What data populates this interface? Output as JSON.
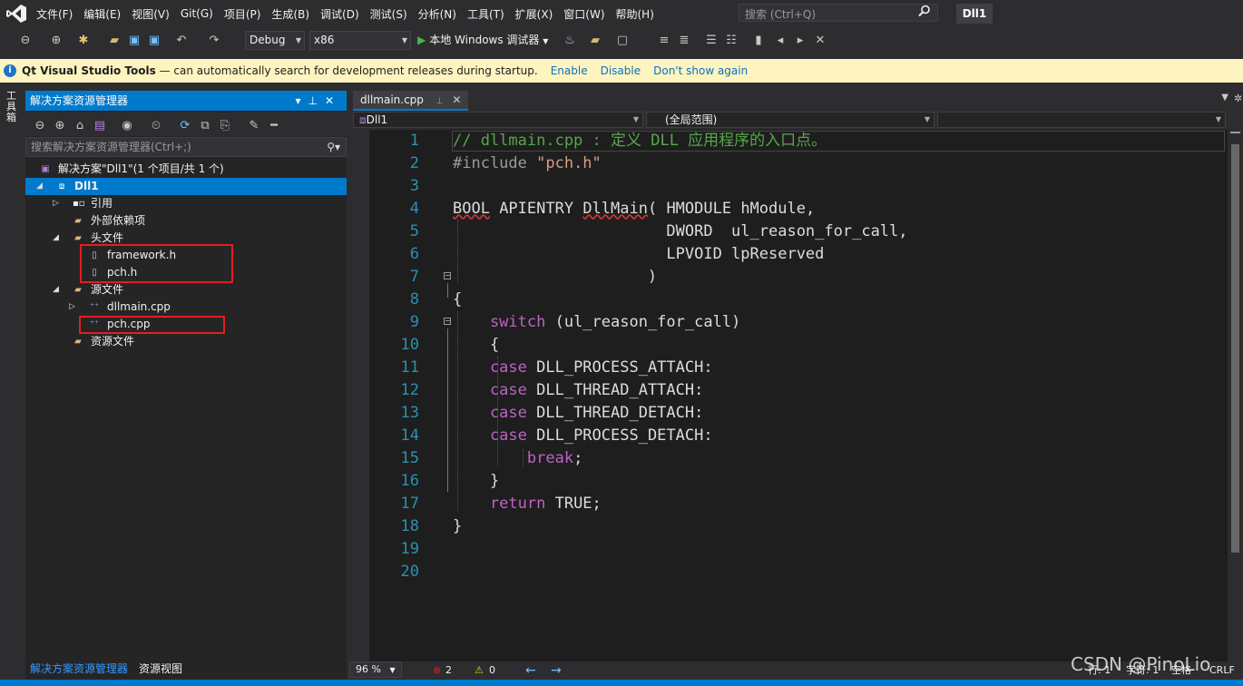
{
  "menubar": {
    "items": [
      "文件(F)",
      "编辑(E)",
      "视图(V)",
      "Git(G)",
      "项目(P)",
      "生成(B)",
      "调试(D)",
      "测试(S)",
      "分析(N)",
      "工具(T)",
      "扩展(X)",
      "窗口(W)",
      "帮助(H)"
    ],
    "search_placeholder": "搜索 (Ctrl+Q)",
    "project_title": "Dll1"
  },
  "toolbar": {
    "config": "Debug",
    "platform": "x86",
    "run_label": "本地 Windows 调试器"
  },
  "infobar": {
    "product": "Qt Visual Studio Tools",
    "message": "—  can automatically search for development releases during startup.",
    "enable": "Enable",
    "disable": "Disable",
    "dont_show": "Don't show again"
  },
  "left_strip": {
    "label": "工具箱"
  },
  "solution_explorer": {
    "title": "解决方案资源管理器",
    "search_placeholder": "搜索解决方案资源管理器(Ctrl+;)",
    "tree": [
      {
        "label": "解决方案\"Dll1\"(1 个项目/共 1 个)"
      },
      {
        "label": "Dll1"
      },
      {
        "label": "引用"
      },
      {
        "label": "外部依赖项"
      },
      {
        "label": "头文件"
      },
      {
        "label": "framework.h"
      },
      {
        "label": "pch.h"
      },
      {
        "label": "源文件"
      },
      {
        "label": "dllmain.cpp"
      },
      {
        "label": "pch.cpp"
      },
      {
        "label": "资源文件"
      }
    ],
    "tabs": [
      "解决方案资源管理器",
      "资源视图"
    ]
  },
  "editor": {
    "tab_label": "dllmain.cpp",
    "nav_project": "Dll1",
    "nav_scope": "(全局范围)",
    "line_numbers": [
      "1",
      "2",
      "3",
      "4",
      "5",
      "6",
      "7",
      "8",
      "9",
      "10",
      "11",
      "12",
      "13",
      "14",
      "15",
      "16",
      "17",
      "18",
      "19",
      "20"
    ],
    "lines": {
      "l1": "// dllmain.cpp : 定义 DLL 应用程序的入口点。",
      "l2a": "#include ",
      "l2b": "\"pch.h\"",
      "l4a": "BOOL",
      "l4b": " APIENTRY ",
      "l4c": "DllMain",
      "l4d": "( HMODULE hModule,",
      "l5": "                       DWORD  ul_reason_for_call,",
      "l6": "                       LPVOID lpReserved",
      "l7": "                     )",
      "l8": "{",
      "l9a": "    switch",
      "l9b": " (ul_reason_for_call)",
      "l10": "    {",
      "l11a": "    case",
      "l11b": " DLL_PROCESS_ATTACH:",
      "l12a": "    case",
      "l12b": " DLL_THREAD_ATTACH:",
      "l13a": "    case",
      "l13b": " DLL_THREAD_DETACH:",
      "l14a": "    case",
      "l14b": " DLL_PROCESS_DETACH:",
      "l15": "        break",
      "l15b": ";",
      "l16": "    }",
      "l17a": "    return",
      "l17b": " TRUE;",
      "l18": "}"
    }
  },
  "status": {
    "zoom": "96 %",
    "errors": "2",
    "warnings": "0",
    "line": "行: 1",
    "char": "字符: 1",
    "mode": "空格",
    "eol": "CRLF"
  },
  "watermark": "CSDN @PinoLio",
  "colors": {
    "accent": "#007acc",
    "highlight_box": "#e51c23",
    "infobar_bg": "#fdf4bf"
  }
}
